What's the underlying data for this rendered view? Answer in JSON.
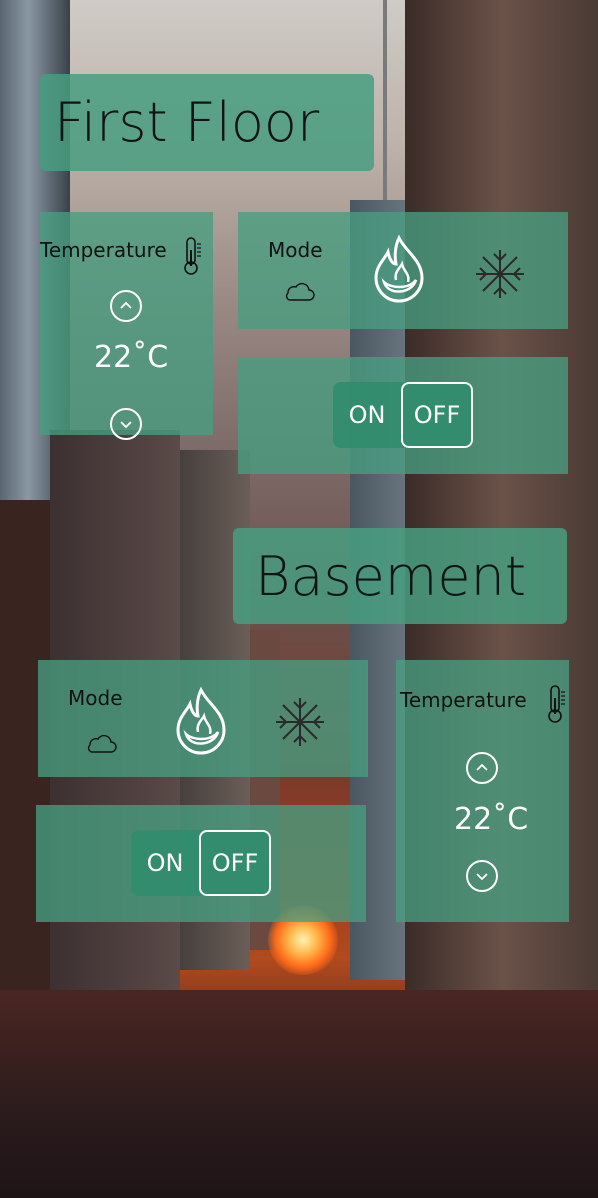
{
  "zones": [
    {
      "title": "First Floor",
      "temperature": {
        "label": "Temperature",
        "value": "22",
        "unit": "˚C"
      },
      "mode": {
        "label": "Mode"
      },
      "power": {
        "on_label": "ON",
        "off_label": "OFF",
        "state": "off"
      }
    },
    {
      "title": "Basement",
      "temperature": {
        "label": "Temperature",
        "value": "22",
        "unit": "˚C"
      },
      "mode": {
        "label": "Mode"
      },
      "power": {
        "on_label": "ON",
        "off_label": "OFF",
        "state": "off"
      }
    }
  ],
  "icons": [
    "thermometer-icon",
    "cloud-icon",
    "flame-icon",
    "snowflake-icon",
    "chevron-up-icon",
    "chevron-down-icon"
  ],
  "colors": {
    "panel": "#489e80",
    "text_dark": "#111111",
    "text_light": "#ffffff"
  }
}
